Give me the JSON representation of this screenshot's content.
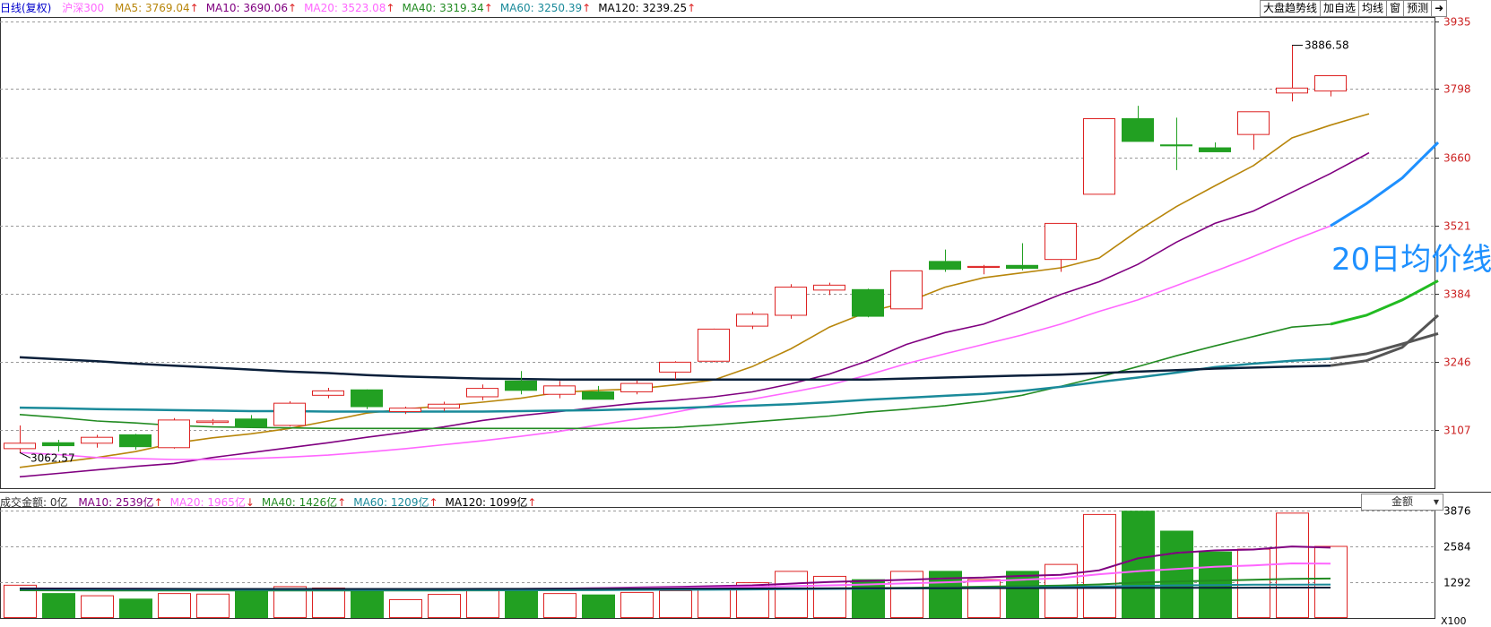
{
  "header": {
    "period": "日线(复权)",
    "symbol": "沪深300",
    "ma": [
      {
        "label": "MA5: 3769.04",
        "arrow": "↑",
        "color": "#b8860b"
      },
      {
        "label": "MA10: 3690.06",
        "arrow": "↑",
        "color": "#800080"
      },
      {
        "label": "MA20: 3523.08",
        "arrow": "↑",
        "color": "#ff66ff"
      },
      {
        "label": "MA40: 3319.34",
        "arrow": "↑",
        "color": "#228b22"
      },
      {
        "label": "MA60: 3250.39",
        "arrow": "↑",
        "color": "#1a8a9a"
      },
      {
        "label": "MA120: 3239.25",
        "arrow": "↑",
        "color": "#000000"
      }
    ]
  },
  "toolbar": {
    "buttons": [
      "大盘趋势线",
      "加自选",
      "均线",
      "窗",
      "预测"
    ],
    "exit_glyph": "➜"
  },
  "volume_header": {
    "amount": "成交金额: 0亿",
    "ma": [
      {
        "label": "MA10: 2539亿",
        "arrow": "↑",
        "color": "#800080"
      },
      {
        "label": "MA20: 1965亿",
        "arrow": "↓",
        "color": "#ff66ff"
      },
      {
        "label": "MA40: 1426亿",
        "arrow": "↑",
        "color": "#228b22"
      },
      {
        "label": "MA60: 1209亿",
        "arrow": "↑",
        "color": "#1a8a9a"
      },
      {
        "label": "MA120: 1099亿",
        "arrow": "↑",
        "color": "#000000"
      }
    ]
  },
  "volume_dropdown": "金额",
  "annotation": "20日均价线",
  "colors": {
    "up": "#dd2222",
    "down": "#22a022",
    "axis_text": "#cc2222",
    "grid": "#999999"
  },
  "chart_data": {
    "type": "candlestick",
    "price_axis": {
      "ticks": [
        3107,
        3246,
        3384,
        3521,
        3660,
        3798,
        3935
      ],
      "ylim": [
        2990,
        3942
      ]
    },
    "volume_axis": {
      "ticks": [
        1292,
        2584,
        3876
      ],
      "ylim": [
        0,
        3876
      ],
      "unit_label": "X100"
    },
    "annotations": [
      {
        "label": "3886.58",
        "type": "high"
      },
      {
        "label": "3062.57",
        "type": "low"
      }
    ],
    "candles": [
      {
        "o": 3070,
        "h": 3117,
        "l": 3062,
        "c": 3081,
        "v": 1200
      },
      {
        "o": 3082,
        "h": 3088,
        "l": 3064,
        "c": 3076,
        "v": 900
      },
      {
        "o": 3081,
        "h": 3098,
        "l": 3072,
        "c": 3093,
        "v": 820
      },
      {
        "o": 3098,
        "h": 3100,
        "l": 3068,
        "c": 3074,
        "v": 700
      },
      {
        "o": 3072,
        "h": 3132,
        "l": 3070,
        "c": 3128,
        "v": 900
      },
      {
        "o": 3123,
        "h": 3130,
        "l": 3118,
        "c": 3126,
        "v": 880
      },
      {
        "o": 3130,
        "h": 3138,
        "l": 3112,
        "c": 3114,
        "v": 1000
      },
      {
        "o": 3117,
        "h": 3166,
        "l": 3115,
        "c": 3162,
        "v": 1150
      },
      {
        "o": 3178,
        "h": 3193,
        "l": 3172,
        "c": 3187,
        "v": 1100
      },
      {
        "o": 3189,
        "h": 3190,
        "l": 3150,
        "c": 3155,
        "v": 1000
      },
      {
        "o": 3145,
        "h": 3155,
        "l": 3140,
        "c": 3152,
        "v": 680
      },
      {
        "o": 3152,
        "h": 3165,
        "l": 3146,
        "c": 3160,
        "v": 870
      },
      {
        "o": 3175,
        "h": 3200,
        "l": 3168,
        "c": 3192,
        "v": 1000
      },
      {
        "o": 3207,
        "h": 3227,
        "l": 3180,
        "c": 3188,
        "v": 1000
      },
      {
        "o": 3180,
        "h": 3207,
        "l": 3172,
        "c": 3197,
        "v": 900
      },
      {
        "o": 3185,
        "h": 3197,
        "l": 3180,
        "c": 3170,
        "v": 850
      },
      {
        "o": 3185,
        "h": 3208,
        "l": 3180,
        "c": 3202,
        "v": 940
      },
      {
        "o": 3225,
        "h": 3247,
        "l": 3210,
        "c": 3245,
        "v": 1000
      },
      {
        "o": 3247,
        "h": 3313,
        "l": 3245,
        "c": 3312,
        "v": 1150
      },
      {
        "o": 3318,
        "h": 3347,
        "l": 3312,
        "c": 3342,
        "v": 1290
      },
      {
        "o": 3340,
        "h": 3403,
        "l": 3333,
        "c": 3397,
        "v": 1700
      },
      {
        "o": 3391,
        "h": 3406,
        "l": 3381,
        "c": 3401,
        "v": 1520
      },
      {
        "o": 3392,
        "h": 3394,
        "l": 3336,
        "c": 3338,
        "v": 1400
      },
      {
        "o": 3353,
        "h": 3430,
        "l": 3353,
        "c": 3430,
        "v": 1700
      },
      {
        "o": 3449,
        "h": 3473,
        "l": 3428,
        "c": 3433,
        "v": 1700
      },
      {
        "o": 3437,
        "h": 3442,
        "l": 3423,
        "c": 3439,
        "v": 1400
      },
      {
        "o": 3441,
        "h": 3486,
        "l": 3431,
        "c": 3435,
        "v": 1700
      },
      {
        "o": 3453,
        "h": 3526,
        "l": 3428,
        "c": 3526,
        "v": 1950
      },
      {
        "o": 3585,
        "h": 3738,
        "l": 3585,
        "c": 3738,
        "v": 3750
      },
      {
        "o": 3738,
        "h": 3764,
        "l": 3696,
        "c": 3692,
        "v": 3870
      },
      {
        "o": 3685,
        "h": 3740,
        "l": 3634,
        "c": 3683,
        "v": 3150
      },
      {
        "o": 3679,
        "h": 3690,
        "l": 3674,
        "c": 3671,
        "v": 2400
      },
      {
        "o": 3706,
        "h": 3752,
        "l": 3675,
        "c": 3752,
        "v": 2500
      },
      {
        "o": 3790,
        "h": 3886.58,
        "l": 3773,
        "c": 3800,
        "v": 3800
      },
      {
        "o": 3794,
        "h": 3825,
        "l": 3783,
        "c": 3825,
        "v": 2600
      }
    ],
    "series": [
      {
        "name": "MA5",
        "color": "#b8860b",
        "values": [
          3032,
          3042,
          3052,
          3064,
          3081,
          3092,
          3100,
          3111,
          3126,
          3142,
          3150,
          3157,
          3164,
          3172,
          3184,
          3188,
          3191,
          3199,
          3209,
          3236,
          3272,
          3316,
          3347,
          3366,
          3397,
          3416,
          3426,
          3436,
          3456,
          3511,
          3560,
          3602,
          3643,
          3699,
          3725,
          3748
        ]
      },
      {
        "name": "MA10",
        "color": "#800080",
        "values": [
          3013,
          3020,
          3027,
          3034,
          3040,
          3052,
          3062,
          3072,
          3082,
          3093,
          3103,
          3114,
          3127,
          3137,
          3145,
          3154,
          3162,
          3168,
          3175,
          3185,
          3201,
          3221,
          3248,
          3281,
          3305,
          3322,
          3351,
          3382,
          3408,
          3443,
          3488,
          3526,
          3551,
          3589,
          3627,
          3669
        ]
      },
      {
        "name": "MA20",
        "color": "#ff66ff",
        "values": [
          3062,
          3058,
          3052,
          3050,
          3048,
          3048,
          3050,
          3053,
          3057,
          3063,
          3070,
          3078,
          3086,
          3095,
          3105,
          3118,
          3130,
          3144,
          3158,
          3170,
          3184,
          3199,
          3219,
          3242,
          3262,
          3281,
          3300,
          3322,
          3348,
          3371,
          3400,
          3429,
          3459,
          3491,
          3521
        ]
      },
      {
        "name": "MA40",
        "color": "#228b22",
        "values": [
          3139,
          3133,
          3126,
          3122,
          3117,
          3114,
          3113,
          3112,
          3111,
          3111,
          3111,
          3111,
          3111,
          3111,
          3111,
          3111,
          3111,
          3113,
          3118,
          3124,
          3130,
          3136,
          3144,
          3150,
          3157,
          3166,
          3178,
          3196,
          3215,
          3236,
          3258,
          3278,
          3297,
          3316,
          3322
        ]
      },
      {
        "name": "MA60",
        "color": "#1a8a9a",
        "values": [
          3153,
          3152,
          3150,
          3149,
          3148,
          3147,
          3146,
          3146,
          3145,
          3145,
          3145,
          3145,
          3145,
          3146,
          3147,
          3148,
          3150,
          3152,
          3155,
          3157,
          3160,
          3164,
          3169,
          3173,
          3177,
          3181,
          3187,
          3195,
          3205,
          3214,
          3224,
          3235,
          3242,
          3248,
          3252
        ]
      },
      {
        "name": "MA120",
        "color": "#0a1f3a",
        "values": [
          3255,
          3251,
          3247,
          3242,
          3238,
          3234,
          3230,
          3226,
          3223,
          3219,
          3216,
          3214,
          3212,
          3211,
          3210,
          3210,
          3210,
          3210,
          3210,
          3210,
          3210,
          3210,
          3210,
          3212,
          3214,
          3216,
          3218,
          3220,
          3223,
          3226,
          3229,
          3232,
          3234,
          3236,
          3238
        ]
      }
    ],
    "projection": [
      {
        "name": "MA20-ext",
        "color": "#1e90ff",
        "values": [
          3521,
          3566,
          3618,
          3690
        ]
      },
      {
        "name": "MA40-ext",
        "color": "#22bb22",
        "values": [
          3322,
          3340,
          3371,
          3410
        ]
      },
      {
        "name": "MA120-ext",
        "color": "#555555",
        "values": [
          3238,
          3248,
          3275,
          3340
        ]
      },
      {
        "name": "MA60-ext",
        "color": "#555555",
        "values": [
          3252,
          3262,
          3282,
          3303
        ]
      }
    ],
    "volume_series": [
      {
        "name": "VMA10",
        "color": "#800080",
        "values": [
          1070,
          1065,
          1060,
          1055,
          1050,
          1045,
          1040,
          1040,
          1040,
          1040,
          1040,
          1042,
          1045,
          1050,
          1060,
          1080,
          1100,
          1120,
          1150,
          1180,
          1240,
          1300,
          1340,
          1380,
          1430,
          1460,
          1520,
          1560,
          1720,
          2150,
          2350,
          2440,
          2470,
          2580,
          2540
        ]
      },
      {
        "name": "VMA20",
        "color": "#ff66ff",
        "values": [
          1020,
          1015,
          1010,
          1010,
          1010,
          1015,
          1020,
          1025,
          1030,
          1030,
          1035,
          1040,
          1045,
          1050,
          1060,
          1070,
          1080,
          1090,
          1100,
          1120,
          1150,
          1180,
          1210,
          1250,
          1290,
          1330,
          1380,
          1440,
          1580,
          1690,
          1770,
          1850,
          1900,
          1970,
          1965
        ]
      },
      {
        "name": "VMA40",
        "color": "#228b22",
        "values": [
          1000,
          998,
          995,
          993,
          992,
          990,
          990,
          990,
          990,
          992,
          994,
          996,
          998,
          1000,
          1005,
          1010,
          1020,
          1030,
          1040,
          1050,
          1060,
          1070,
          1080,
          1090,
          1110,
          1130,
          1150,
          1170,
          1210,
          1280,
          1320,
          1350,
          1380,
          1410,
          1426
        ]
      },
      {
        "name": "VMA60",
        "color": "#1a8a9a",
        "values": [
          1040,
          1035,
          1030,
          1026,
          1022,
          1020,
          1018,
          1016,
          1014,
          1012,
          1010,
          1010,
          1010,
          1010,
          1010,
          1012,
          1014,
          1016,
          1020,
          1030,
          1040,
          1050,
          1060,
          1070,
          1080,
          1090,
          1100,
          1120,
          1140,
          1160,
          1180,
          1190,
          1200,
          1205,
          1209
        ]
      },
      {
        "name": "VMA120",
        "color": "#0a1f3a",
        "values": [
          1060,
          1058,
          1056,
          1054,
          1052,
          1050,
          1050,
          1050,
          1050,
          1050,
          1050,
          1050,
          1052,
          1054,
          1056,
          1058,
          1060,
          1062,
          1064,
          1066,
          1068,
          1070,
          1072,
          1074,
          1076,
          1078,
          1080,
          1082,
          1085,
          1088,
          1090,
          1093,
          1095,
          1097,
          1099
        ]
      }
    ]
  }
}
